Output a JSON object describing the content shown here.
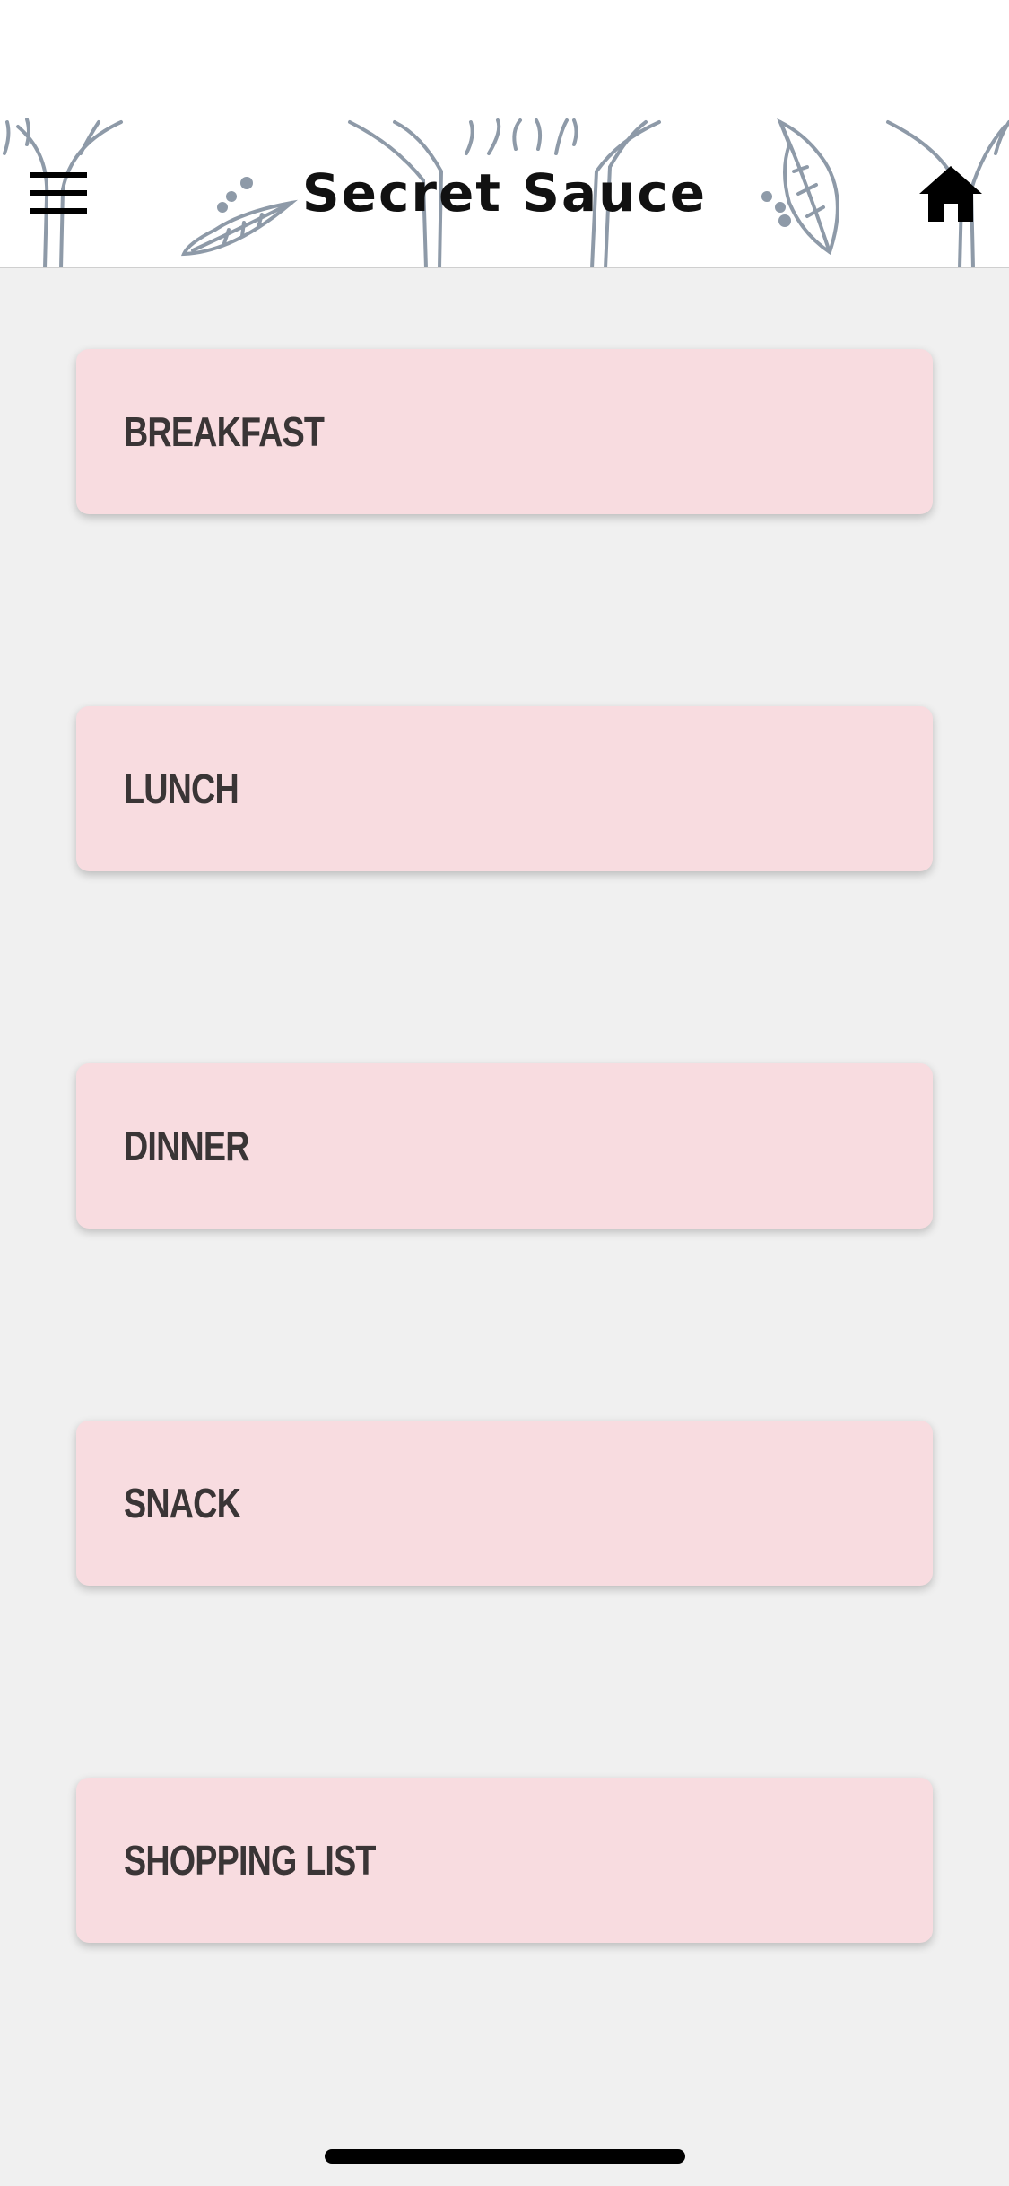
{
  "header": {
    "title": "Secret Sauce",
    "menu_icon": "hamburger-menu-icon",
    "home_icon": "home-icon",
    "decor_color": "#8e9aa8"
  },
  "menu": {
    "items": [
      {
        "label": "BREAKFAST"
      },
      {
        "label": "LUNCH"
      },
      {
        "label": "DINNER"
      },
      {
        "label": "SNACK"
      },
      {
        "label": "SHOPPING LIST"
      }
    ],
    "card_color": "#f8dce0",
    "text_color": "#3a3536"
  },
  "colors": {
    "background": "#f0f0f0",
    "header_background": "#ffffff"
  }
}
